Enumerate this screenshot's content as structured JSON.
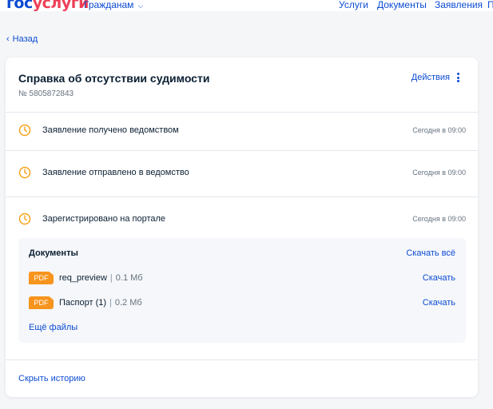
{
  "header": {
    "logo_part1": "гос",
    "logo_part2": "услуги",
    "audience_label": "Гражданам",
    "nav": [
      "Услуги",
      "Документы",
      "Заявления",
      "П"
    ]
  },
  "back_label": "Назад",
  "card": {
    "title": "Справка об отсутствии судимости",
    "number": "№ 5805872843",
    "actions_label": "Действия",
    "events": [
      {
        "text": "Заявление получено ведомством",
        "time": "Сегодня в 09:00"
      },
      {
        "text": "Заявление отправлено в ведомство",
        "time": "Сегодня в 09:00"
      },
      {
        "text": "Зарегистрировано на портале",
        "time": "Сегодня в 09:00"
      }
    ],
    "documents": {
      "title": "Документы",
      "download_all": "Скачать всё",
      "files": [
        {
          "type": "PDF",
          "name": "req_preview",
          "separator": "|",
          "size": "0.1 Мб",
          "download": "Скачать"
        },
        {
          "type": "PDF",
          "name": "Паспорт (1)",
          "separator": "|",
          "size": "0.2 Мб",
          "download": "Скачать"
        }
      ],
      "more_files": "Ещё файлы"
    },
    "hide_history": "Скрыть историю"
  },
  "colors": {
    "brand_blue": "#0d4cd3",
    "brand_red": "#ee3f58",
    "clock_orange": "#f7a31a",
    "pdf_orange": "#f7941d"
  },
  "icons": [
    "back-arrow-icon",
    "chevron-down-icon",
    "kebab-menu-icon",
    "clock-icon",
    "pdf-icon"
  ]
}
